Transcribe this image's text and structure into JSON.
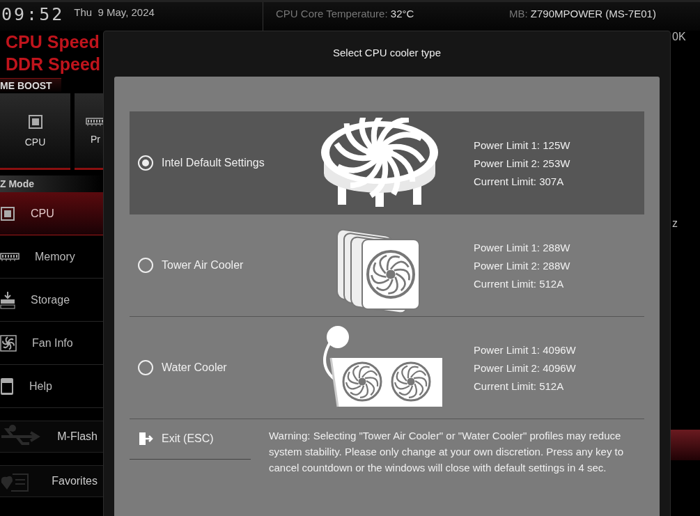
{
  "header": {
    "time": "09:52",
    "date": "Thu  9 May, 2024",
    "sensors": [
      {
        "label": "CPU Core Temperature:",
        "value": "32°C"
      }
    ],
    "system": [
      {
        "label": "MB:",
        "value": "Z790MPOWER (MS-7E01)"
      }
    ],
    "cpu_fragment": "0K"
  },
  "speeds": [
    "CPU Speed",
    "DDR Speed"
  ],
  "boost_tab": "ME BOOST",
  "boost_tiles": [
    {
      "label": "CPU"
    },
    {
      "label": "Pr"
    }
  ],
  "mode_label": "Z Mode",
  "sidebar": {
    "items": [
      {
        "label": "CPU",
        "selected": true
      },
      {
        "label": "Memory",
        "selected": false
      },
      {
        "label": "Storage",
        "selected": false
      },
      {
        "label": "Fan Info",
        "selected": false
      },
      {
        "label": "Help",
        "selected": false
      }
    ]
  },
  "tools": [
    {
      "label": "M-Flash"
    },
    {
      "label": "Favorites"
    }
  ],
  "right_fragment": "z",
  "dialog": {
    "title": "Select CPU cooler type",
    "options": [
      {
        "label": "Intel Default Settings",
        "selected": true,
        "kind": "stock",
        "specs": [
          "Power Limit 1: 125W",
          "Power Limit 2: 253W",
          "Current Limit: 307A"
        ]
      },
      {
        "label": "Tower Air Cooler",
        "selected": false,
        "kind": "tower",
        "specs": [
          "Power Limit 1: 288W",
          "Power Limit 2: 288W",
          "Current Limit: 512A"
        ]
      },
      {
        "label": "Water Cooler",
        "selected": false,
        "kind": "water",
        "specs": [
          "Power Limit 1: 4096W",
          "Power Limit 2: 4096W",
          "Current Limit: 512A"
        ]
      }
    ],
    "exit_button": "Exit (ESC)",
    "warning": "Warning: Selecting \"Tower Air Cooler\" or \"Water Cooler\" profiles may reduce system stability. Please only change at your own discretion. Press any key to cancel countdown or the windows will close with default settings in 4 sec."
  }
}
